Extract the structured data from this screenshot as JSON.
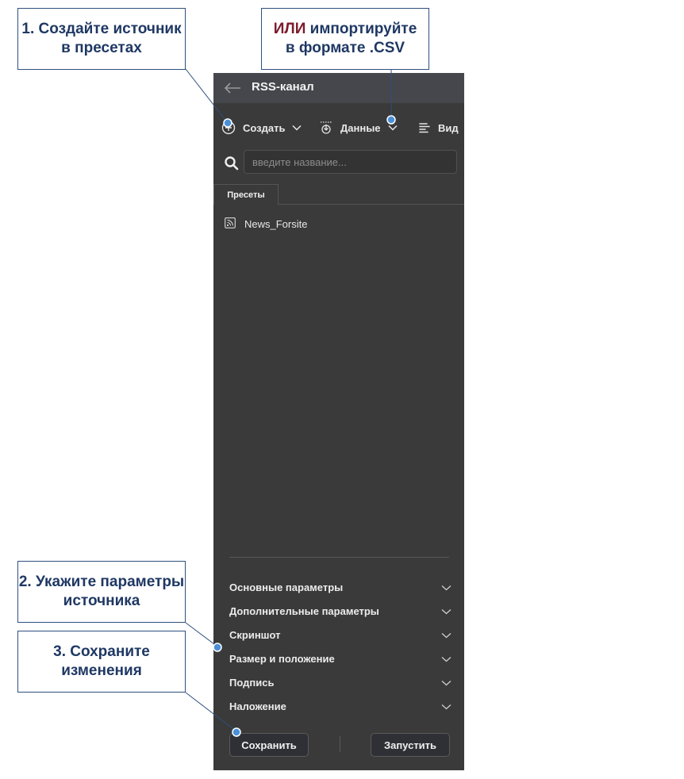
{
  "window": {
    "title": "RSS-канал"
  },
  "toolbar": {
    "create_label": "Создать",
    "data_label": "Данные",
    "view_label": "Вид"
  },
  "search": {
    "placeholder": "введите название...",
    "value": ""
  },
  "tabs": [
    {
      "label": "Пресеты",
      "active": true
    }
  ],
  "presets": [
    {
      "name": "News_Forsite",
      "icon": "rss-icon"
    }
  ],
  "sections": [
    {
      "label": "Основные параметры"
    },
    {
      "label": "Дополнительные параметры"
    },
    {
      "label": "Скриншот"
    },
    {
      "label": "Размер и положение"
    },
    {
      "label": "Подпись"
    },
    {
      "label": "Наложение"
    }
  ],
  "buttons": {
    "save_label": "Сохранить",
    "run_label": "Запустить"
  },
  "callouts": {
    "step1": {
      "line1": "1. Создайте источник",
      "line2": "в пресетах"
    },
    "step1_alt": {
      "accent": "ИЛИ",
      "line1_rest": " импортируйте",
      "line2": "в формате .CSV"
    },
    "step2": {
      "line1": "2. Укажите параметры",
      "line2": "источника"
    },
    "step3": {
      "line1": "3. Сохраните",
      "line2": "изменения"
    }
  },
  "colors": {
    "panel_bg": "#3a3a3a",
    "titlebar_bg": "#46474c",
    "callout_text": "#1f3864",
    "callout_accent": "#7b1c2c",
    "leader_dot": "#4a90d9"
  }
}
